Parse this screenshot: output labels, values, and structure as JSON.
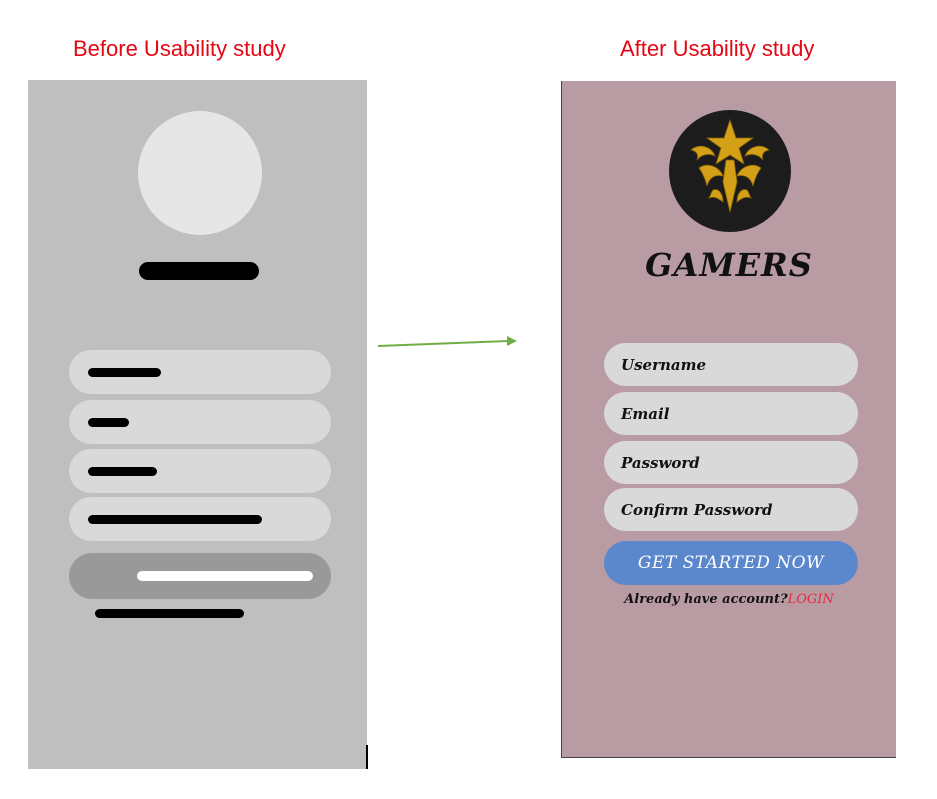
{
  "captions": {
    "before": "Before Usability study",
    "after": "After Usability study"
  },
  "after_screen": {
    "app_title": "GAMERS",
    "logo_icon": "golden-mask-emblem-icon",
    "fields": [
      {
        "placeholder": "Username"
      },
      {
        "placeholder": "Email"
      },
      {
        "placeholder": "Password"
      },
      {
        "placeholder": "Confirm Password"
      }
    ],
    "cta_label": "GET STARTED NOW",
    "login_prompt": "Already have account?",
    "login_link": "LOGIN"
  },
  "colors": {
    "caption": "#e30613",
    "before_bg": "#bfbfbf",
    "after_bg": "#b99ca3",
    "cta": "#5b87cc",
    "login_link": "#e8283c",
    "arrow": "#70ad47"
  }
}
